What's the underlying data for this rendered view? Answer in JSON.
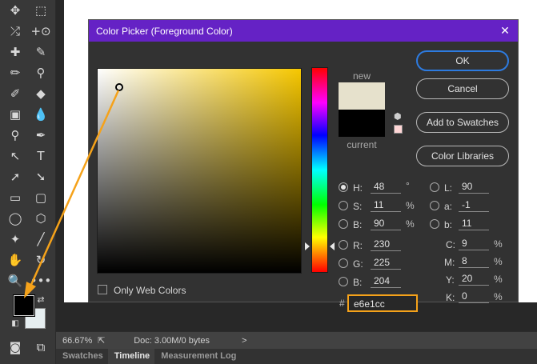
{
  "dialog": {
    "title": "Color Picker (Foreground Color)",
    "new_label": "new",
    "current_label": "current",
    "new_color": "#e6e1cc",
    "current_color": "#000000",
    "buttons": {
      "ok": "OK",
      "cancel": "Cancel",
      "add_to_swatches": "Add to Swatches",
      "color_libraries": "Color Libraries"
    },
    "only_web_colors": "Only Web Colors",
    "fields": {
      "H": {
        "label": "H:",
        "value": "48",
        "unit": "°"
      },
      "S": {
        "label": "S:",
        "value": "11",
        "unit": "%"
      },
      "Bv": {
        "label": "B:",
        "value": "90",
        "unit": "%"
      },
      "R": {
        "label": "R:",
        "value": "230"
      },
      "G": {
        "label": "G:",
        "value": "225"
      },
      "Bb": {
        "label": "B:",
        "value": "204"
      },
      "L": {
        "label": "L:",
        "value": "90"
      },
      "a": {
        "label": "a:",
        "value": "-1"
      },
      "b": {
        "label": "b:",
        "value": "11"
      },
      "C": {
        "label": "C:",
        "value": "9",
        "unit": "%"
      },
      "M": {
        "label": "M:",
        "value": "8",
        "unit": "%"
      },
      "Y": {
        "label": "Y:",
        "value": "20",
        "unit": "%"
      },
      "K": {
        "label": "K:",
        "value": "0",
        "unit": "%"
      }
    },
    "hash": "#",
    "hex": "e6e1cc"
  },
  "status": {
    "zoom": "66.67%",
    "doc": "Doc: 3.00M/0 bytes",
    "arrow": ">"
  },
  "panels": {
    "tabs": [
      "Swatches",
      "Timeline",
      "Measurement Log"
    ]
  },
  "colors": {
    "title_bar": "#6522c5",
    "highlight": "#f5a21a",
    "ok_border": "#2d7be0",
    "foreground": "#000000",
    "background": "#e6eef0"
  },
  "tools": [
    "move-icon",
    "marquee-icon",
    "eyedropper-icon",
    "lasso-icon",
    "crop-icon",
    "frame-icon",
    "healing-icon",
    "brush-icon",
    "pencil-icon",
    "stamp-icon",
    "history-brush-icon",
    "eraser-icon",
    "gradient-icon",
    "blur-icon",
    "dodge-icon",
    "pen-icon",
    "path-select-icon",
    "type-icon",
    "direct-select-icon",
    "rectangle-icon",
    "ellipse-icon",
    "hexagon-icon",
    "custom-shape-icon",
    "line-icon",
    "hand-icon",
    "rotate-view-icon",
    "zoom-icon",
    "more-icon",
    "swap-icon",
    "default-colors-icon",
    "quick-mask-icon",
    "screen-mode-icon"
  ]
}
